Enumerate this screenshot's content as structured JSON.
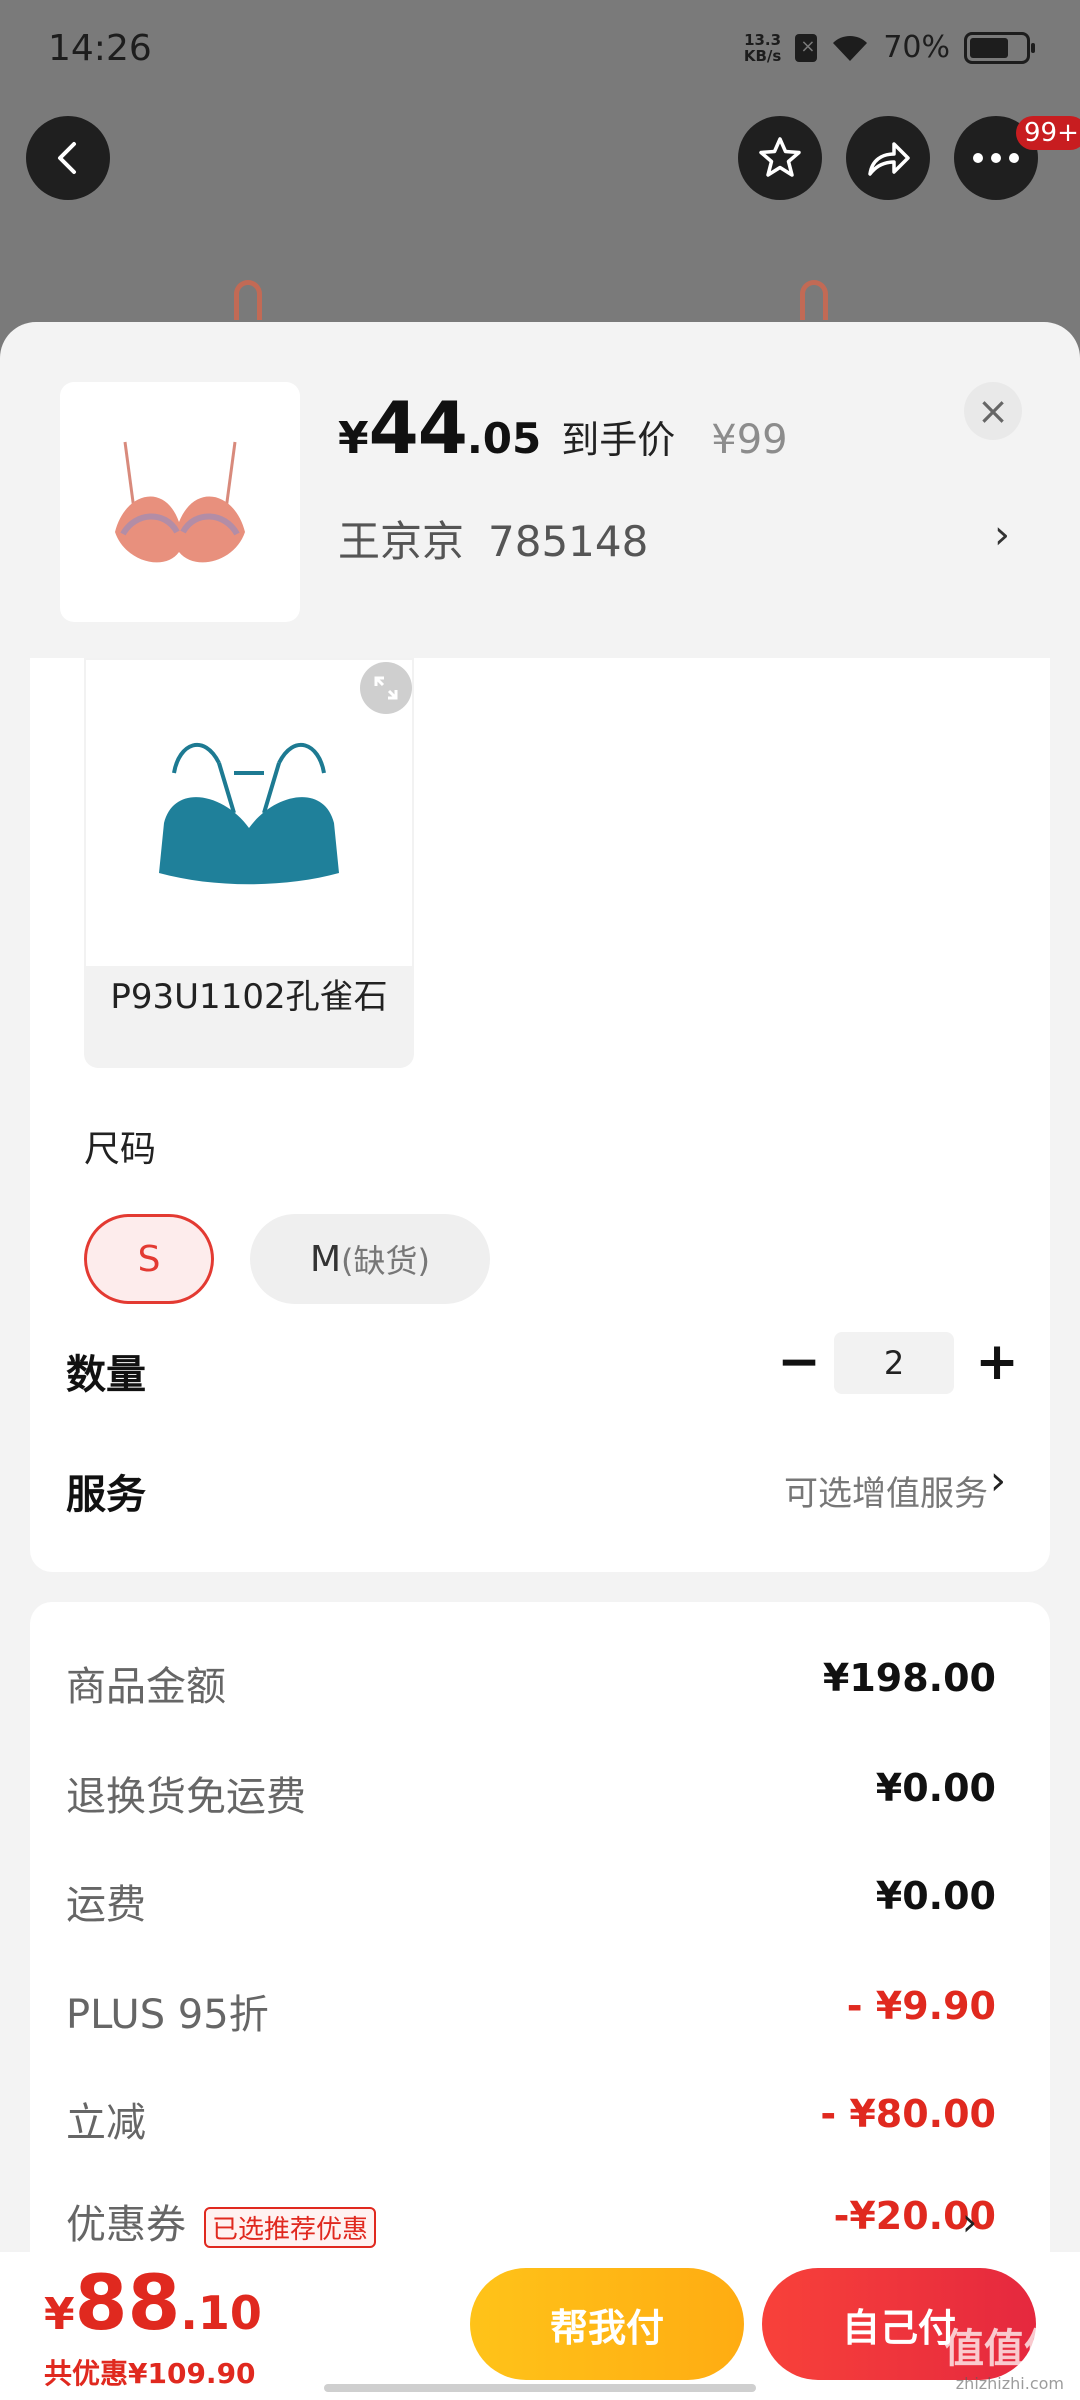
{
  "status_bar": {
    "time": "14:26",
    "net_speed_top": "13.3",
    "net_speed_bottom": "KB/s",
    "battery_percent": "70%",
    "battery_level": 0.7
  },
  "top_actions": {
    "badge": "99+"
  },
  "product": {
    "price_currency": "¥",
    "price_int": "44",
    "price_dec": ".05",
    "price_label": "到手价",
    "original_price": "¥99",
    "seller_name": "王京京",
    "seller_id": "785148",
    "close_label": "×"
  },
  "color_option": {
    "name": "P93U1102孔雀石"
  },
  "size": {
    "title": "尺码",
    "options": [
      {
        "label": "S",
        "selected": true
      },
      {
        "label": "M",
        "note": "(缺货)",
        "selected": false
      }
    ]
  },
  "quantity": {
    "label": "数量",
    "value": "2",
    "minus": "−",
    "plus": "+"
  },
  "service": {
    "label": "服务",
    "value": "可选增值服务"
  },
  "summary": [
    {
      "label": "商品金额",
      "value": "¥198.00",
      "red": false
    },
    {
      "label": "退换货免运费",
      "value": "¥0.00",
      "red": false
    },
    {
      "label": "运费",
      "value": "¥0.00",
      "red": false
    },
    {
      "label": "PLUS 95折",
      "value": "- ¥9.90",
      "red": true
    },
    {
      "label": "立减",
      "value": "- ¥80.00",
      "red": true
    },
    {
      "label": "优惠券",
      "tag": "已选推荐优惠",
      "value": "-¥20.00",
      "red": true
    }
  ],
  "bottom_bar": {
    "total_currency": "¥",
    "total_int": "88",
    "total_dec": ".10",
    "saving": "共优惠¥109.90",
    "help_pay": "帮我付",
    "self_pay": "自己付"
  },
  "watermark": {
    "text": "值值值",
    "sub": "zhizhizhi.com"
  },
  "colors": {
    "accent_red": "#e0291f",
    "help_btn": "#ffb616",
    "self_btn": "#ee3540"
  }
}
